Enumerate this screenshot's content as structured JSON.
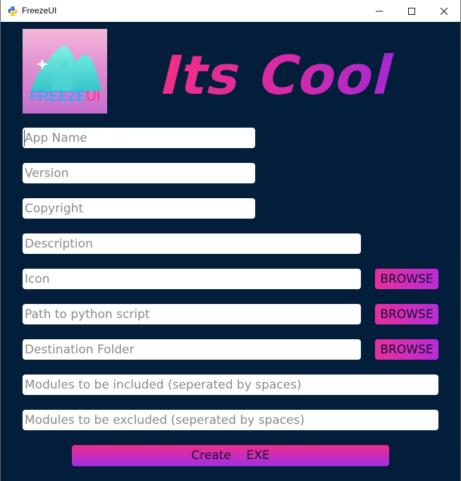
{
  "window": {
    "title": "FreezeUI"
  },
  "logo": {
    "text_main": "FREEZE",
    "text_accent": "UI"
  },
  "hero": {
    "text": "Its Cool"
  },
  "fields": {
    "app_name": {
      "placeholder": "App Name"
    },
    "version": {
      "placeholder": "Version"
    },
    "copyright": {
      "placeholder": "Copyright"
    },
    "description": {
      "placeholder": "Description"
    },
    "icon": {
      "placeholder": "Icon"
    },
    "script_path": {
      "placeholder": "Path to python script"
    },
    "destination": {
      "placeholder": "Destination Folder"
    },
    "modules_included": {
      "placeholder": "Modules to be included (seperated by spaces)"
    },
    "modules_excluded": {
      "placeholder": "Modules to be excluded (seperated by spaces)"
    }
  },
  "buttons": {
    "browse_icon": "BROWSE",
    "browse_script": "BROWSE",
    "browse_destination": "BROWSE",
    "create": "Create    EXE"
  },
  "colors": {
    "background": "#031e3b",
    "accent_pink": "#e5309a",
    "accent_purple": "#b92cd9"
  }
}
